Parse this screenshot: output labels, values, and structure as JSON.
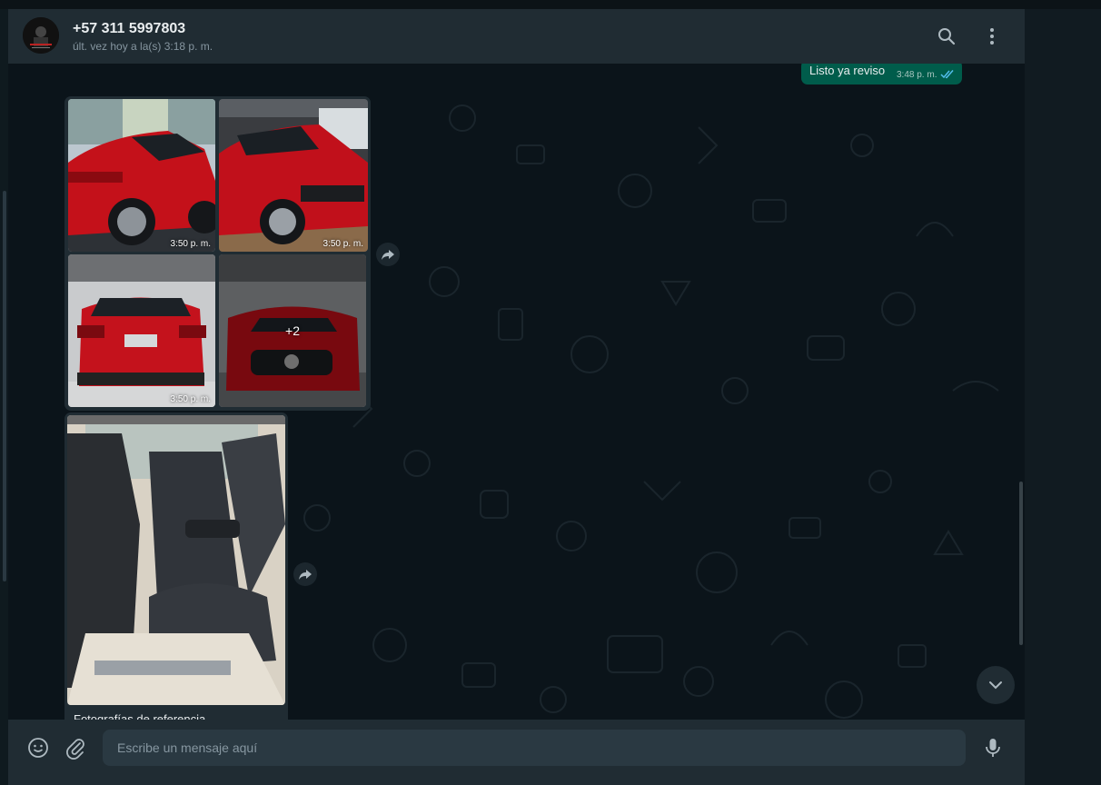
{
  "header": {
    "contact_name": "+57 311 5997803",
    "last_seen": "últ. vez hoy a la(s) 3:18 p. m."
  },
  "messages": {
    "outgoing": {
      "text": "Listo ya reviso",
      "time": "3:48 p. m.",
      "status": "read"
    },
    "album": {
      "tiles": [
        {
          "time": "3:50 p. m."
        },
        {
          "time": "3:50 p. m."
        },
        {
          "time": "3:50 p. m."
        },
        {
          "more_count": "+2"
        }
      ]
    },
    "single_image": {
      "caption": "Fotografías de referencia"
    }
  },
  "composer": {
    "placeholder": "Escribe un mensaje aquí"
  },
  "colors": {
    "header_bg": "#202c33",
    "chat_bg": "#0b141a",
    "outgoing_bubble": "#005c4b",
    "read_ticks": "#53bdeb"
  }
}
